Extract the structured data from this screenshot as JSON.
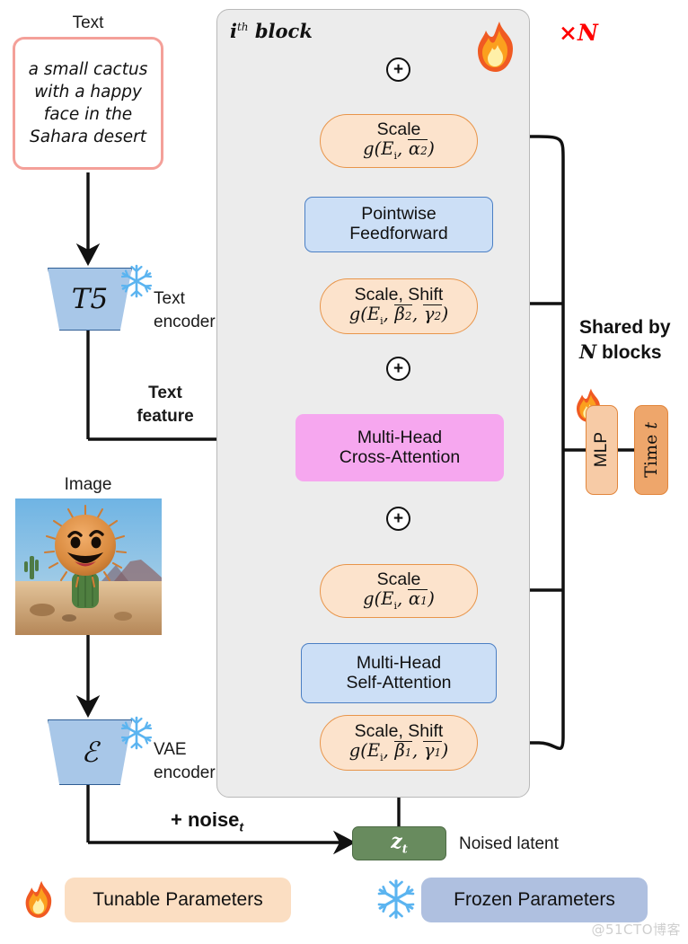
{
  "left_column": {
    "text_caption": "Text",
    "prompt": "a small cactus with a happy face in the Sahara desert",
    "text_encoder_symbol": "T5",
    "text_encoder_label": "Text encoder",
    "text_feature_label": "Text feature",
    "image_caption": "Image",
    "vae_encoder_symbol": "ℰ",
    "vae_encoder_label": "VAE encoder",
    "noise_label": "+ noise",
    "noise_label_sub": "t"
  },
  "block": {
    "title_prefix": "i",
    "title_sup": "th",
    "title_word": "block",
    "repeat_label_times": "×",
    "repeat_label_n": "N",
    "nodes": [
      {
        "id": "scale2",
        "line1": "Scale",
        "math": "g(Eᵢ, α̲₂)",
        "kind": "orange"
      },
      {
        "id": "ff",
        "line1": "Pointwise",
        "line2": "Feedforward",
        "kind": "blue"
      },
      {
        "id": "scaleshift2",
        "line1": "Scale, Shift",
        "math": "g(Eᵢ, β̲₂, γ̲₂)",
        "kind": "orange"
      },
      {
        "id": "crossattn",
        "line1": "Multi-Head",
        "line2": "Cross-Attention",
        "kind": "pink"
      },
      {
        "id": "scale1",
        "line1": "Scale",
        "math": "g(Eᵢ, α̲₁)",
        "kind": "orange"
      },
      {
        "id": "selfattn",
        "line1": "Multi-Head",
        "line2": "Self-Attention",
        "kind": "blue"
      },
      {
        "id": "scaleshift1",
        "line1": "Scale, Shift",
        "math": "g(Eᵢ, β̲₁, γ̲₁)",
        "kind": "orange"
      }
    ],
    "plus_symbol": "+"
  },
  "conditioning": {
    "shared_label_line1": "Shared by",
    "shared_label_n": "N",
    "shared_label_line2": " blocks",
    "mlp_label": "MLP",
    "time_label_prefix": "Time ",
    "time_label_var": "t"
  },
  "latent": {
    "symbol": "z",
    "symbol_sub": "t",
    "caption": "Noised latent"
  },
  "legend": {
    "tunable": "Tunable Parameters",
    "frozen": "Frozen Parameters"
  },
  "watermark": "@51CTO博客",
  "colors": {
    "orange_fill": "#FCE3CC",
    "orange_stroke": "#E8954A",
    "blue_fill": "#CCDFF6",
    "blue_stroke": "#4B7FC4",
    "pink_fill": "#F6A7EF",
    "green_fill": "#688B5E",
    "panel_fill": "#ECECEC",
    "prompt_stroke": "#F4A099",
    "trap_fill": "#A8C7E8",
    "accent_red": "#FF0000",
    "mlp_fill": "#F7CBA6",
    "time_fill": "#EEA66B",
    "legend_tunable_fill": "#FBDEC2",
    "legend_frozen_fill": "#AFC0E0"
  }
}
